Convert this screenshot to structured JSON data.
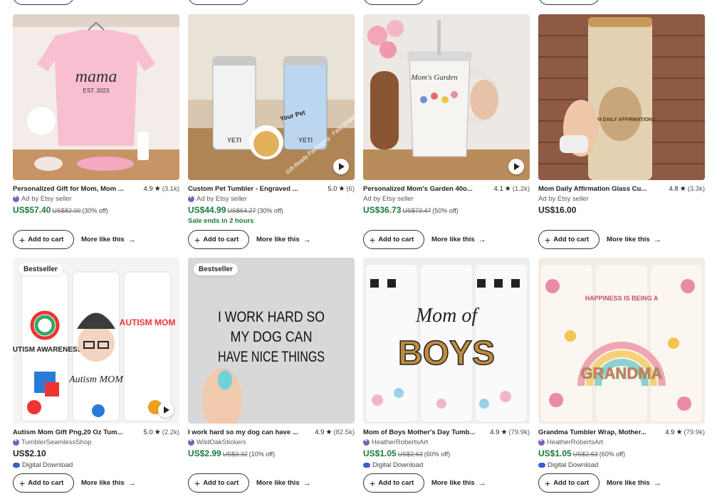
{
  "actions": {
    "add_to_cart": "Add to cart",
    "more_like_this": "More like this"
  },
  "products": [
    {
      "title": "Personalized Gift for Mom, Mom ...",
      "rating": "4.9",
      "count": "(3.1k)",
      "seller": "Ad by Etsy seller",
      "price": "US$57.40",
      "original": "US$82.00",
      "discount": "(30% off)",
      "img_text": "mama",
      "img_sub": "EST. 2023"
    },
    {
      "title": "Custom Pet Tumbler - Engraved ...",
      "rating": "5.0",
      "count": "(6)",
      "seller": "Ad by Etsy seller",
      "price": "US$44.99",
      "original": "US$64.27",
      "discount": "(30% off)",
      "sale_ends": "Sale ends in 2 hours",
      "img_tag": "Your Pet",
      "img_banner": "Gift-Ready Packaging · Fast Shipping",
      "brand": "YETI"
    },
    {
      "title": "Personalized Mom's Garden 40o...",
      "rating": "4.1",
      "count": "(1.2k)",
      "seller": "Ad by Etsy seller",
      "price": "US$36.73",
      "original": "US$73.47",
      "discount": "(50% off)",
      "img_text": "Mom's Garden"
    },
    {
      "title": "Mom Daily Affirmation Glass Cu...",
      "rating": "4.8",
      "count": "(3.3k)",
      "seller": "Ad by Etsy seller",
      "price": "US$16.00",
      "img_text": "MOM DAILY AFFIRMATIONS"
    },
    {
      "title": "Autism Mom Gift Png,20 Oz Tum...",
      "rating": "5.0",
      "count": "(2.2k)",
      "seller": "TumblerSeamlessShop",
      "price": "US$2.10",
      "digital": "Digital Download",
      "badge": "Bestseller",
      "img_text1": "AUTISM AWARENESS",
      "img_text2": "Autism MOM",
      "img_text3": "AUTISM MOM"
    },
    {
      "title": "I work hard so my dog can have ...",
      "rating": "4.9",
      "count": "(82.5k)",
      "seller": "WildOakStickers",
      "price": "US$2.99",
      "original": "US$3.32",
      "discount": "(10% off)",
      "badge": "Bestseller",
      "img_lines": [
        "I WORK HARD SO",
        "MY DOG CAN",
        "HAVE NICE THINGS"
      ]
    },
    {
      "title": "Mom of Boys Mother's Day Tumb...",
      "rating": "4.9",
      "count": "(79.9k)",
      "seller": "HeatherRobertsArt",
      "price": "US$1.05",
      "original": "US$2.63",
      "discount": "(60% off)",
      "digital": "Digital Download",
      "img_text": "Mom of",
      "img_big": "BOYS"
    },
    {
      "title": "Grandma Tumbler Wrap, Mother...",
      "rating": "4.9",
      "count": "(79.9k)",
      "seller": "HeatherRobertsArt",
      "price": "US$1.05",
      "original": "US$2.63",
      "discount": "(60% off)",
      "digital": "Digital Download",
      "img_text": "HAPPINESS IS BEING A",
      "img_big": "GRANDMA"
    }
  ]
}
